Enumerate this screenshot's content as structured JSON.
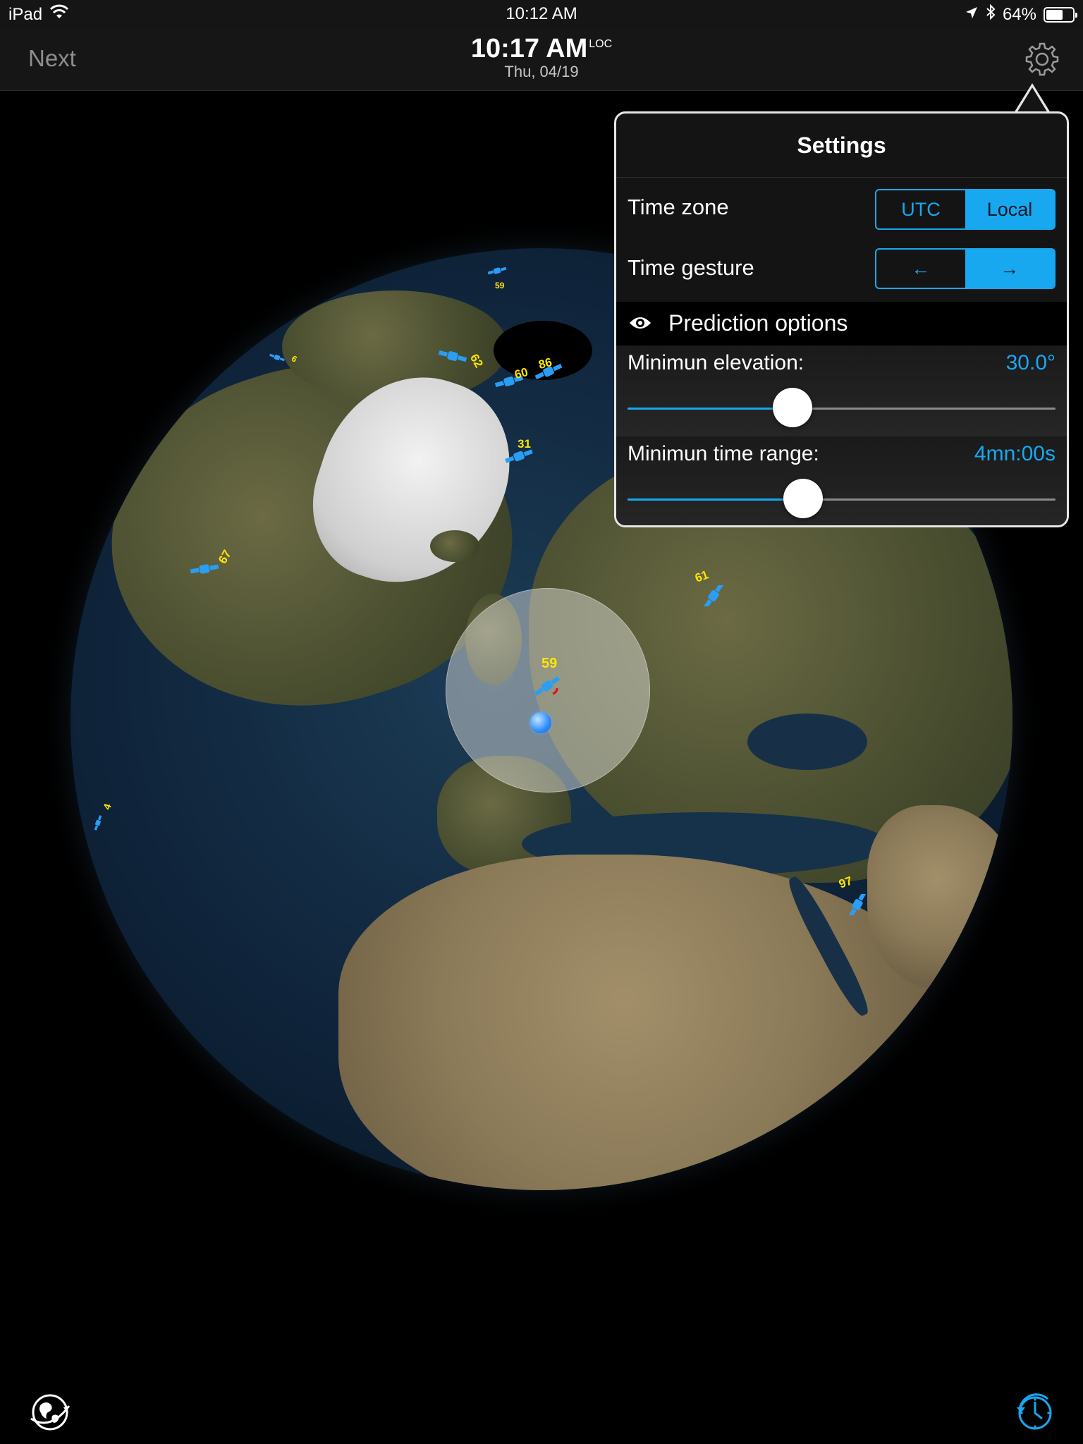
{
  "status_bar": {
    "device": "iPad",
    "time": "10:12 AM",
    "battery": "64%",
    "battery_level": 0.64
  },
  "nav": {
    "left_button": "Next",
    "time": "10:17 AM",
    "time_suffix": "LOC",
    "date": "Thu, 04/19"
  },
  "settings": {
    "title": "Settings",
    "time_zone": {
      "label": "Time zone",
      "options": [
        "UTC",
        "Local"
      ],
      "selected": "Local"
    },
    "time_gesture": {
      "label": "Time gesture",
      "options": [
        "←",
        "→"
      ],
      "selected": "→"
    },
    "section_title": "Prediction options",
    "min_elevation": {
      "label": "Minimun elevation:",
      "value": "30.0°",
      "fraction": 0.386
    },
    "min_time_range": {
      "label": "Minimun time range:",
      "value": "4mn:00s",
      "fraction": 0.41
    }
  },
  "satellites": [
    {
      "label": "59"
    },
    {
      "label": "61"
    },
    {
      "label": "97"
    },
    {
      "label": "31"
    },
    {
      "label": "60"
    },
    {
      "label": "86"
    },
    {
      "label": "62"
    },
    {
      "label": "67"
    },
    {
      "label": "59"
    },
    {
      "label": "4"
    },
    {
      "label": "6"
    }
  ],
  "colors": {
    "accent": "#18a8f0",
    "satellite_label": "#ffe600",
    "satellite_icon": "#2a9df4"
  }
}
